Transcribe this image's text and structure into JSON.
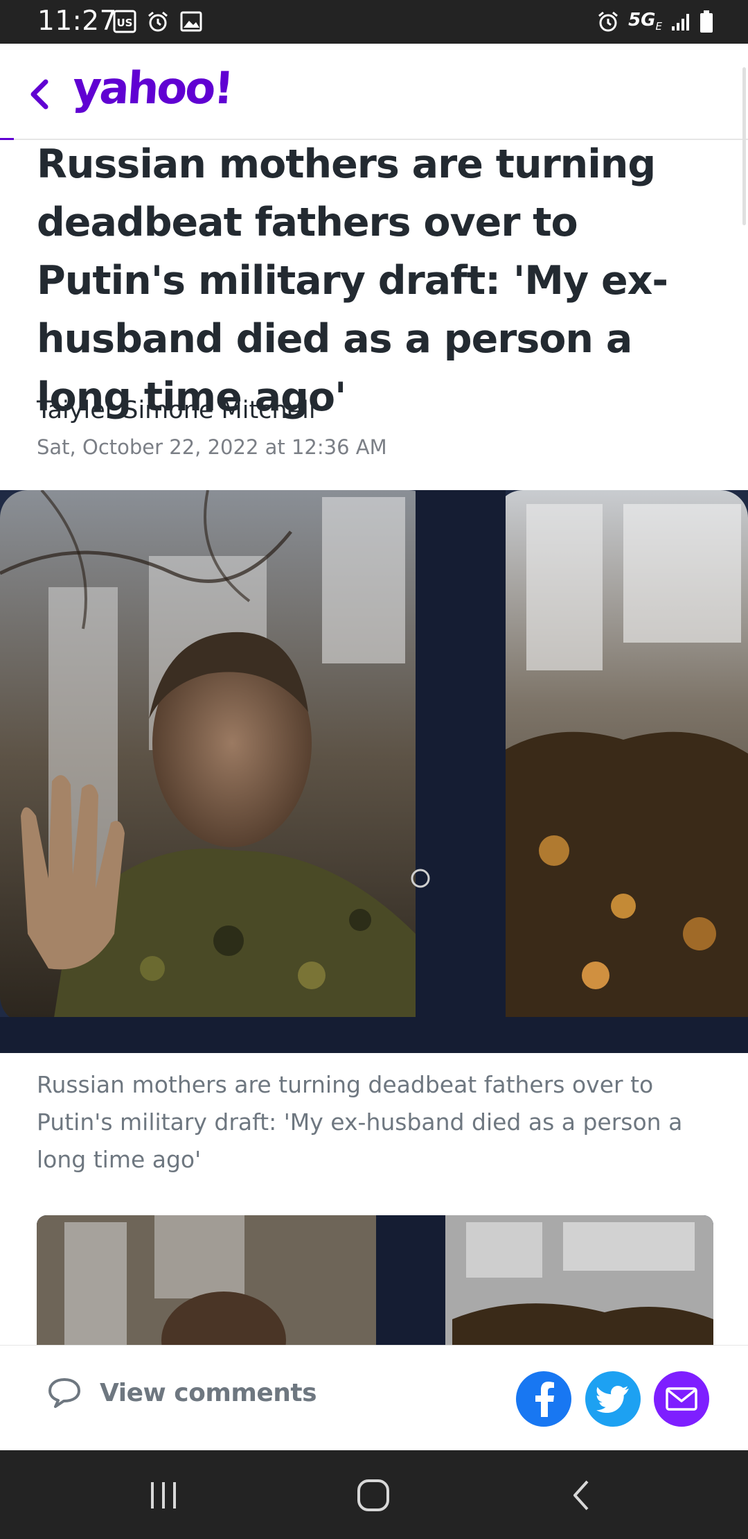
{
  "status_bar": {
    "time": "11:27",
    "network": "5G",
    "network_sub": "E",
    "icons": [
      "us-badge-icon",
      "alarm-icon",
      "gallery-icon",
      "alarm-icon",
      "signal-icon",
      "battery-icon"
    ]
  },
  "header": {
    "logo_text": "yahoo!",
    "back_icon": "chevron-left-icon",
    "brand_color": "#6001d2"
  },
  "article": {
    "headline": "Russian mothers are turning deadbeat fathers over to Putin's military draft: 'My ex-husband died as a person a long time ago'",
    "author": "Taiyler Simone Mitchell",
    "date": "Sat, October 22, 2022 at 12:36 AM",
    "caption": "Russian mothers are turning deadbeat fathers over to Putin's military draft: 'My ex-husband died as a person a long time ago'"
  },
  "action_bar": {
    "comments_label": "View comments",
    "comments_icon": "speech-bubble-icon",
    "share_buttons": [
      {
        "name": "facebook",
        "icon": "facebook-icon",
        "color": "#1877f2"
      },
      {
        "name": "twitter",
        "icon": "twitter-icon",
        "color": "#1da1f2"
      },
      {
        "name": "email",
        "icon": "mail-icon",
        "color": "#7e1fff"
      }
    ]
  },
  "nav_bar": {
    "buttons": [
      "recent-apps-icon",
      "home-icon",
      "back-icon"
    ]
  }
}
